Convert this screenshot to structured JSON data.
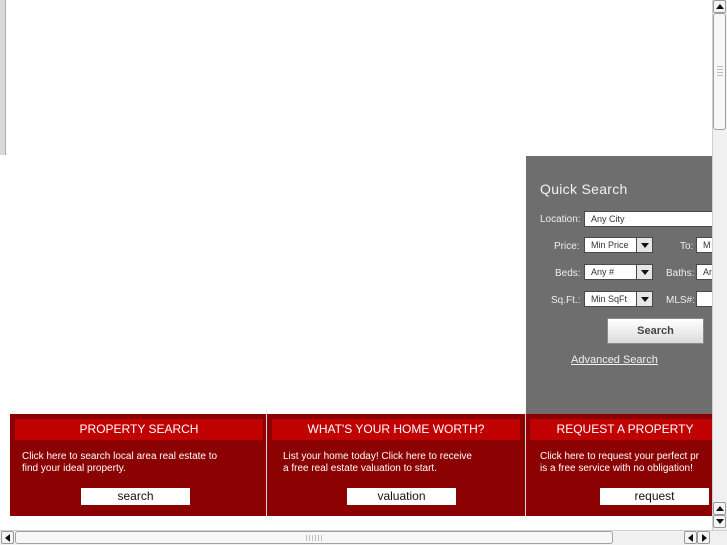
{
  "quick_search": {
    "title": "Quick Search",
    "location_label": "Location:",
    "location_value": "Any City",
    "price_label": "Price:",
    "price_min": "Min Price",
    "to_label": "To:",
    "price_max": "M",
    "beds_label": "Beds:",
    "beds_value": "Any #",
    "baths_label": "Baths:",
    "baths_value": "An",
    "sqft_label": "Sq.Ft.:",
    "sqft_value": "Min SqFt",
    "mls_label": "MLS#:",
    "search_button": "Search",
    "advanced_link": "Advanced Search"
  },
  "panels": [
    {
      "title": "PROPERTY SEARCH",
      "text_line1": "Click here to search local area real estate to",
      "text_line2": "find your ideal property.",
      "button": "search"
    },
    {
      "title": "WHAT'S YOUR HOME WORTH?",
      "text_line1": "List your home today! Click here to receive",
      "text_line2": "a free real estate valuation to start.",
      "button": "valuation"
    },
    {
      "title": "REQUEST A PROPERTY",
      "text_line1": "Click here to request your perfect pr",
      "text_line2": "is a free service with no obligation!",
      "button": "request"
    }
  ],
  "colors": {
    "panel_bg": "#8b0000",
    "panel_header": "#c00000",
    "quick_search_bg": "#6e6e6e"
  }
}
